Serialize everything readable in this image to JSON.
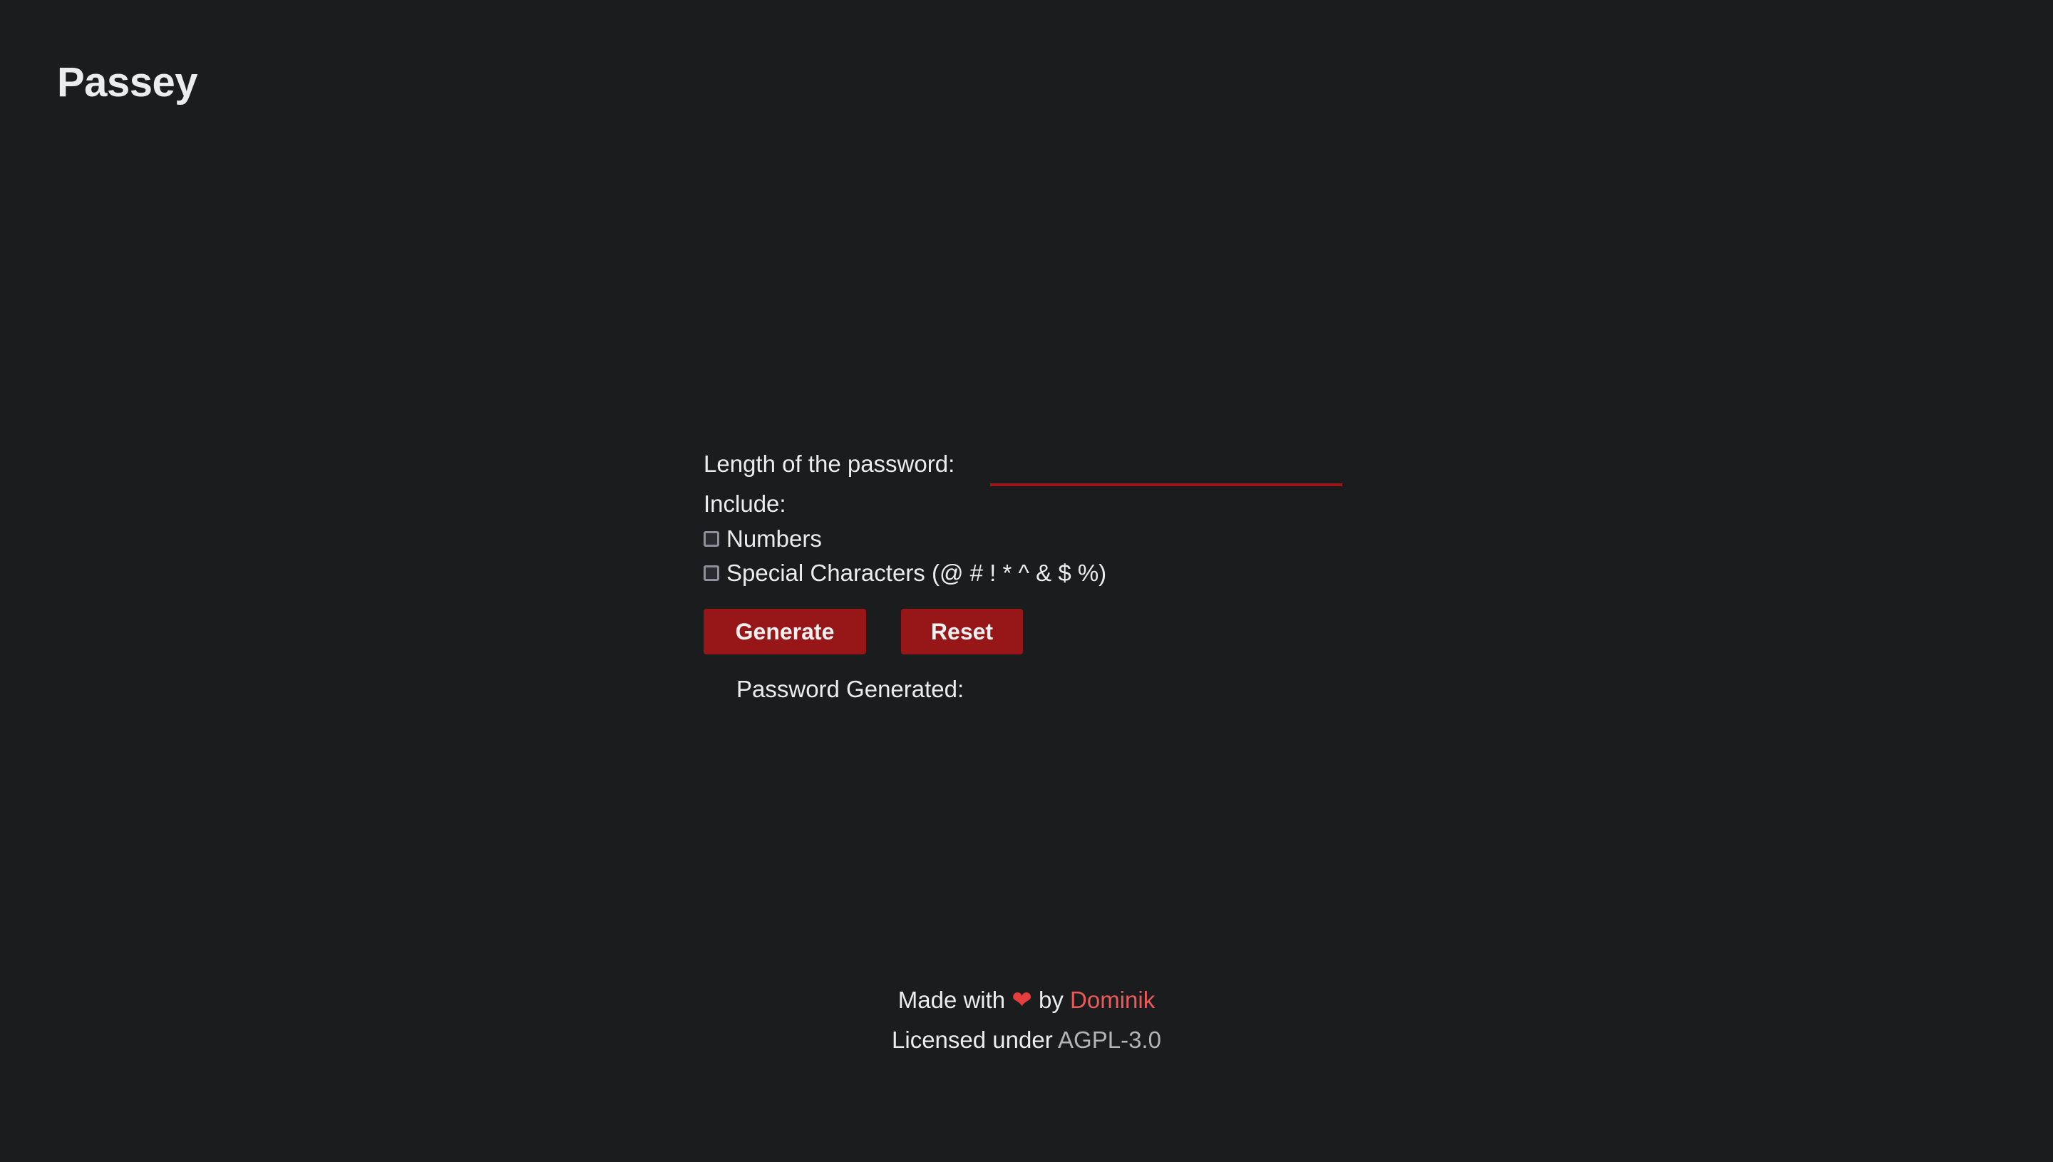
{
  "app": {
    "logo": "Passey"
  },
  "form": {
    "length_label": "Length of the password:",
    "length_value": "",
    "include_label": "Include:",
    "options": [
      {
        "label": "Numbers",
        "checked": false
      },
      {
        "label": "Special Characters (@ # ! * ^ & $ %)",
        "checked": false
      }
    ],
    "generate_label": "Generate",
    "reset_label": "Reset",
    "result_label": "Password Generated:"
  },
  "footer": {
    "made_with": "Made with",
    "heart": "❤",
    "by": "by",
    "author": "Dominik",
    "licensed_under": "Licensed under",
    "license": "AGPL-3.0"
  },
  "colors": {
    "background": "#1b1c1e",
    "accent": "#971718",
    "author_link": "#ea5a5a",
    "heart": "#e63e3e"
  }
}
